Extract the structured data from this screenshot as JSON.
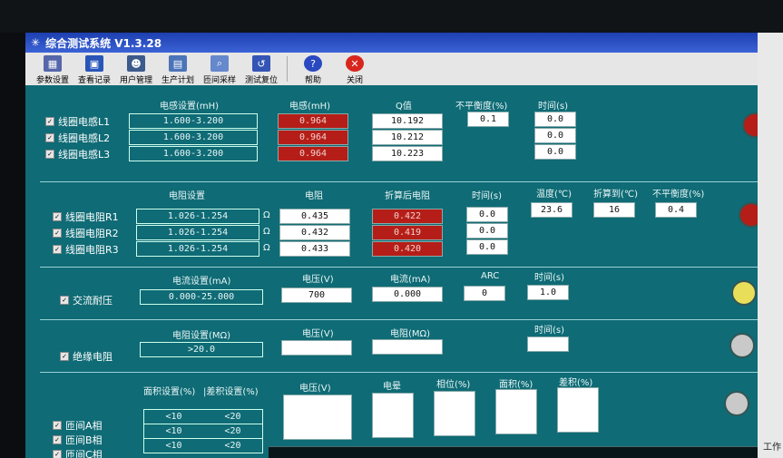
{
  "window": {
    "title": "综合测试系统 V1.3.28"
  },
  "toolbar": [
    {
      "label": "参数设置",
      "icon": "params-icon",
      "color": "#5566aa"
    },
    {
      "label": "查看记录",
      "icon": "save-icon",
      "color": "#2855b8"
    },
    {
      "label": "用户管理",
      "icon": "user-icon",
      "color": "#3c5a8c"
    },
    {
      "label": "生产计划",
      "icon": "plan-icon",
      "color": "#4c74b8"
    },
    {
      "label": "匝间采样",
      "icon": "sample-icon",
      "color": "#6688cc"
    },
    {
      "label": "测试复位",
      "icon": "reset-icon",
      "color": "#3455b5"
    },
    {
      "label": "帮助",
      "icon": "help-icon",
      "color": "#2a48c0"
    },
    {
      "label": "关闭",
      "icon": "close-icon",
      "color": "#d7261e"
    }
  ],
  "inductance": {
    "headers": {
      "setting": "电感设置(mH)",
      "value": "电感(mH)",
      "q": "Q值",
      "unbalance": "不平衡度(%)",
      "time": "时间(s)"
    },
    "rows": [
      {
        "label": "线圈电感L1",
        "setting": "1.600-3.200",
        "value": "0.964",
        "q": "10.192",
        "time": "0.0"
      },
      {
        "label": "线圈电感L2",
        "setting": "1.600-3.200",
        "value": "0.964",
        "q": "10.212",
        "time": "0.0"
      },
      {
        "label": "线圈电感L3",
        "setting": "1.600-3.200",
        "value": "0.964",
        "q": "10.223",
        "time": "0.0"
      }
    ],
    "unbalance": "0.1",
    "status_color": "#b51e18"
  },
  "resistance": {
    "headers": {
      "setting": "电阻设置",
      "value": "电阻",
      "converted": "折算后电阻",
      "time": "时间(s)",
      "temp": "温度(℃)",
      "convert_to": "折算到(℃)",
      "unbalance": "不平衡度(%)"
    },
    "unit": "Ω",
    "rows": [
      {
        "label": "线圈电阻R1",
        "setting": "1.026-1.254",
        "value": "0.435",
        "converted": "0.422",
        "time": "0.0"
      },
      {
        "label": "线圈电阻R2",
        "setting": "1.026-1.254",
        "value": "0.432",
        "converted": "0.419",
        "time": "0.0"
      },
      {
        "label": "线圈电阻R3",
        "setting": "1.026-1.254",
        "value": "0.433",
        "converted": "0.420",
        "time": "0.0"
      }
    ],
    "temp": "23.6",
    "convert_to": "16",
    "unbalance": "0.4",
    "status_color": "#b51e18"
  },
  "ac_withstand": {
    "label": "交流耐压",
    "headers": {
      "setting": "电流设置(mA)",
      "voltage": "电压(V)",
      "current": "电流(mA)",
      "arc": "ARC",
      "time": "时间(s)"
    },
    "setting": "0.000-25.000",
    "voltage": "700",
    "current": "0.000",
    "arc": "0",
    "time": "1.0",
    "status_color": "#e8de5a"
  },
  "insulation": {
    "label": "绝缘电阻",
    "headers": {
      "setting": "电阻设置(MΩ)",
      "voltage": "电压(V)",
      "resistance": "电阻(MΩ)",
      "time": "时间(s)"
    },
    "setting": ">20.0",
    "status_color": "#c9c9c9"
  },
  "interturn": {
    "headers": {
      "area": "面积设置(%)",
      "diff": "|差积设置(%)",
      "voltage": "电压(V)",
      "charge": "电晕",
      "phase": "相位(%)",
      "area_val": "面积(%)",
      "diff_val": "差积(%)"
    },
    "rows": [
      {
        "label": "匝间A相",
        "area": "<10",
        "diff": "<20"
      },
      {
        "label": "匝间B相",
        "area": "<10",
        "diff": "<20"
      },
      {
        "label": "匝间C相",
        "area": "<10",
        "diff": "<20"
      }
    ],
    "status_color": "#c9c9c9"
  },
  "side": {
    "work": "工作"
  }
}
